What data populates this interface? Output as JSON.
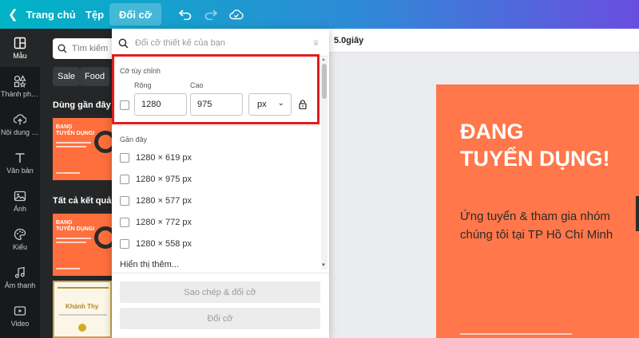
{
  "topbar": {
    "home": "Trang chủ",
    "file": "Tệp",
    "resize": "Đổi cỡ"
  },
  "rail": [
    {
      "label": "Mẫu",
      "icon": "template-icon"
    },
    {
      "label": "Thành phần",
      "icon": "elements-icon"
    },
    {
      "label": "Nội dung t...",
      "icon": "upload-icon"
    },
    {
      "label": "Văn bản",
      "icon": "text-icon"
    },
    {
      "label": "Ảnh",
      "icon": "photo-icon"
    },
    {
      "label": "Kiểu",
      "icon": "styles-icon"
    },
    {
      "label": "Âm thanh",
      "icon": "audio-icon"
    },
    {
      "label": "Video",
      "icon": "video-icon"
    }
  ],
  "panel": {
    "search_placeholder": "Tìm kiếm",
    "chips": [
      "Sale",
      "Food"
    ],
    "recent_heading": "Dùng gần đây",
    "all_heading": "Tất cả kết quả",
    "thumb_title": "ĐANG\nTUYỂN DỤNG!",
    "cert_name": "Khánh Thy"
  },
  "canvas": {
    "duration": "5.0giây",
    "title": "ĐANG\nTUYỂN DỤNG!",
    "subtitle": "Ứng tuyển & tham gia nhóm\nchúng tôi tại TP Hồ Chí Minh"
  },
  "resize": {
    "search_placeholder": "Đổi cỡ thiết kế của bạn",
    "custom_title": "Cỡ tùy chỉnh",
    "width_label": "Rộng",
    "height_label": "Cao",
    "width_value": "1280",
    "height_value": "975",
    "unit": "px",
    "recent_title": "Gần đây",
    "recent": [
      "1280 × 619 px",
      "1280 × 975 px",
      "1280 × 577 px",
      "1280 × 772 px",
      "1280 × 558 px"
    ],
    "show_more": "Hiển thị thêm...",
    "copy_button": "Sao chép & đổi cỡ",
    "resize_button": "Đổi cỡ"
  },
  "colors": {
    "accent_orange": "#ff774a",
    "highlight_red": "#e11d1d"
  }
}
